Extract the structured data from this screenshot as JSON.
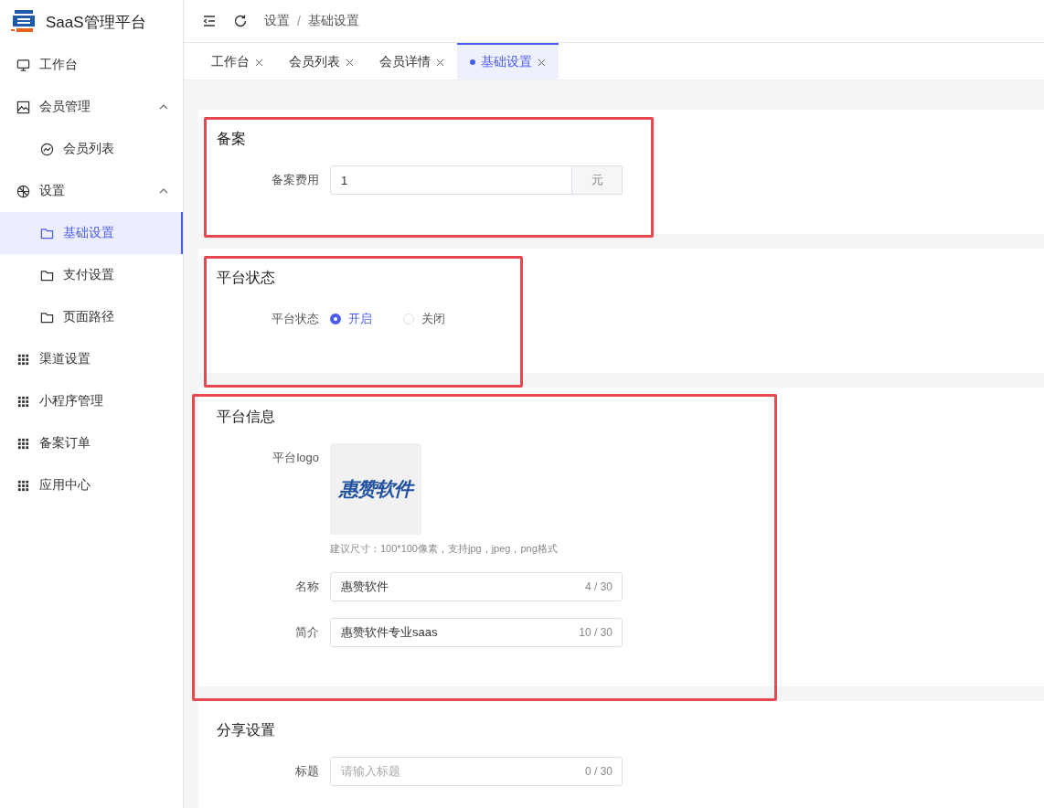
{
  "brand": {
    "title": "SaaS管理平台"
  },
  "sidebar": {
    "items": [
      {
        "label": "工作台",
        "selected": false
      },
      {
        "label": "会员管理",
        "selected": false,
        "expanded": true,
        "children": [
          {
            "label": "会员列表",
            "selected": false
          }
        ]
      },
      {
        "label": "设置",
        "selected": false,
        "expanded": true,
        "children": [
          {
            "label": "基础设置",
            "selected": true
          },
          {
            "label": "支付设置",
            "selected": false
          },
          {
            "label": "页面路径",
            "selected": false
          }
        ]
      },
      {
        "label": "渠道设置",
        "selected": false
      },
      {
        "label": "小程序管理",
        "selected": false
      },
      {
        "label": "备案订单",
        "selected": false
      },
      {
        "label": "应用中心",
        "selected": false
      }
    ]
  },
  "breadcrumb": [
    "设置",
    "基础设置"
  ],
  "breadcrumb_separator": "/",
  "tabs": [
    {
      "label": "工作台",
      "selected": false
    },
    {
      "label": "会员列表",
      "selected": false
    },
    {
      "label": "会员详情",
      "selected": false
    },
    {
      "label": "基础设置",
      "selected": true
    }
  ],
  "sections": [
    {
      "title": "备案",
      "fields": [
        {
          "kind": "append",
          "label": "备案费用",
          "value": "1",
          "suffix": "元"
        }
      ]
    },
    {
      "title": "平台状态",
      "fields": [
        {
          "kind": "radio",
          "label": "平台状态",
          "options": [
            {
              "label": "开启",
              "selected": true
            },
            {
              "label": "关闭",
              "selected": false
            }
          ]
        }
      ]
    },
    {
      "title": "平台信息",
      "fields": [
        {
          "kind": "upload",
          "label": "平台logo",
          "logo_text": "惠赞软件",
          "hint": "建议尺寸：100*100像素，支持jpg，jpeg，png格式"
        },
        {
          "kind": "counted",
          "label": "名称",
          "value": "惠赞软件",
          "count": "4 / 30"
        },
        {
          "kind": "counted",
          "label": "简介",
          "value": "惠赞软件专业saas",
          "count": "10 / 30"
        }
      ]
    },
    {
      "title": "分享设置",
      "fields": [
        {
          "kind": "counted",
          "label": "标题",
          "placeholder": "请输入标题",
          "count": "0 / 30"
        }
      ]
    }
  ]
}
